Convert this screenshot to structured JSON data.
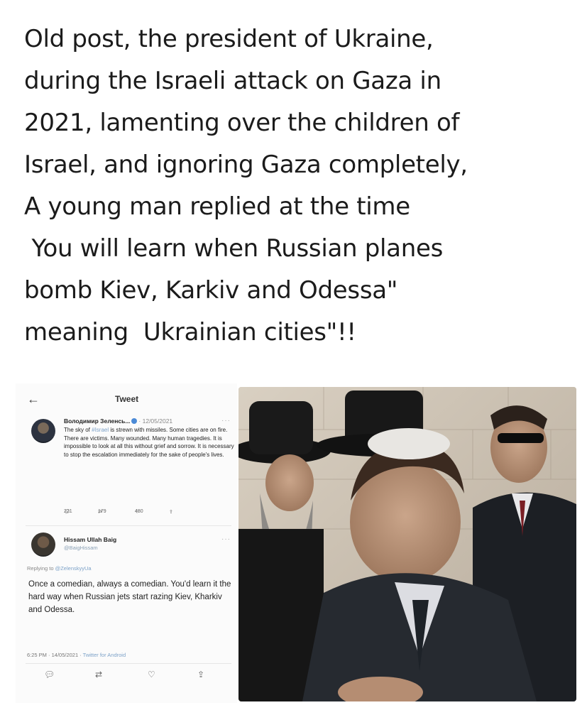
{
  "caption": {
    "lines": [
      "Old post, the president of Ukraine,",
      "during the Israeli attack on Gaza in",
      "2021, lamenting over the children of",
      "Israel, and ignoring Gaza completely,",
      "A young man replied at the time",
      " You will learn when Russian planes",
      "bomb Kiev, Karkiv and Odessa\"",
      "meaning  Ukrainian cities\"!!"
    ]
  },
  "tweet": {
    "back_icon": "arrow-left-icon",
    "title": "Tweet",
    "original": {
      "author": "Володимир Зеленсь...",
      "date": "· 12/05/2021",
      "text_pre": "The sky of ",
      "hashtag": "#Israel",
      "text_post": " is strewn with missiles. Some cities are on fire. There are victims. Many wounded. Many human tragedies. It is impossible to look at all this without grief and sorrow. It is necessary to stop the escalation immediately for the sake of people's lives.",
      "replies": "221",
      "retweets": "179",
      "likes": "480"
    },
    "reply": {
      "author": "Hissam Ullah Baig",
      "handle": "@BaigHissam",
      "replying_prefix": "Replying to ",
      "replying_to": "@ZelenskyyUa",
      "text": "Once a comedian, always a comedian. You'd learn it the hard way when Russian jets start razing Kiev, Kharkiv and Odessa.",
      "timestamp": "6:25 PM · 14/05/2021 · ",
      "client": "Twitter for Android"
    }
  },
  "colors": {
    "link": "#7da2c8",
    "verified": "#4b8ad6",
    "text": "#1b1b1b"
  }
}
